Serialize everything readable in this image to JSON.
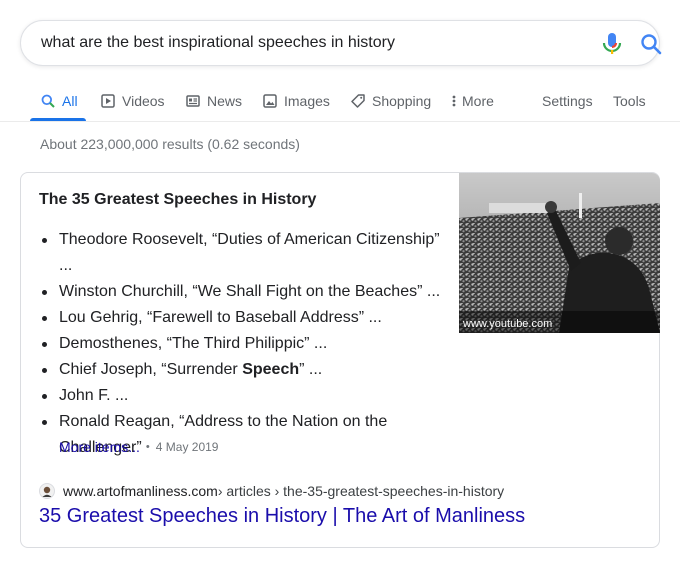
{
  "search": {
    "query": "what are the best inspirational speeches in history"
  },
  "tabs": [
    {
      "label": "All",
      "icon": "search-icon",
      "active": true
    },
    {
      "label": "Videos",
      "icon": "play-icon"
    },
    {
      "label": "News",
      "icon": "news-icon"
    },
    {
      "label": "Images",
      "icon": "image-icon"
    },
    {
      "label": "Shopping",
      "icon": "tag-icon"
    },
    {
      "label": "More",
      "icon": "more-dots-icon"
    }
  ],
  "tools": {
    "settings": "Settings",
    "tools": "Tools"
  },
  "stats": "About 223,000,000 results (0.62 seconds)",
  "featured": {
    "title": "The 35 Greatest Speeches in History",
    "items": [
      {
        "text": "Theodore Roosevelt, “Duties of American Citizenship”",
        "cont": "..."
      },
      {
        "text": "Winston Churchill, “We Shall Fight on the Beaches” ..."
      },
      {
        "text": "Lou Gehrig, “Farewell to Baseball Address” ..."
      },
      {
        "text": "Demosthenes, “The Third Philippic” ..."
      },
      {
        "pre": "Chief Joseph, “Surrender ",
        "bold": "Speech",
        "post": "” ..."
      },
      {
        "text": "John F. ..."
      },
      {
        "text": "Ronald Reagan, “Address to the Nation on the Challenger”"
      }
    ],
    "more_label": "More items...",
    "separator": "•",
    "date": "4 May 2019",
    "image_caption": "www.youtube.com"
  },
  "result": {
    "url": "www.artofmanliness.com",
    "breadcrumb": " › articles › the-35-greatest-speeches-in-history",
    "title": "35 Greatest Speeches in History | The Art of Manliness"
  },
  "colors": {
    "accent": "#1a73e8",
    "link": "#1a0dab",
    "muted": "#70757a"
  }
}
